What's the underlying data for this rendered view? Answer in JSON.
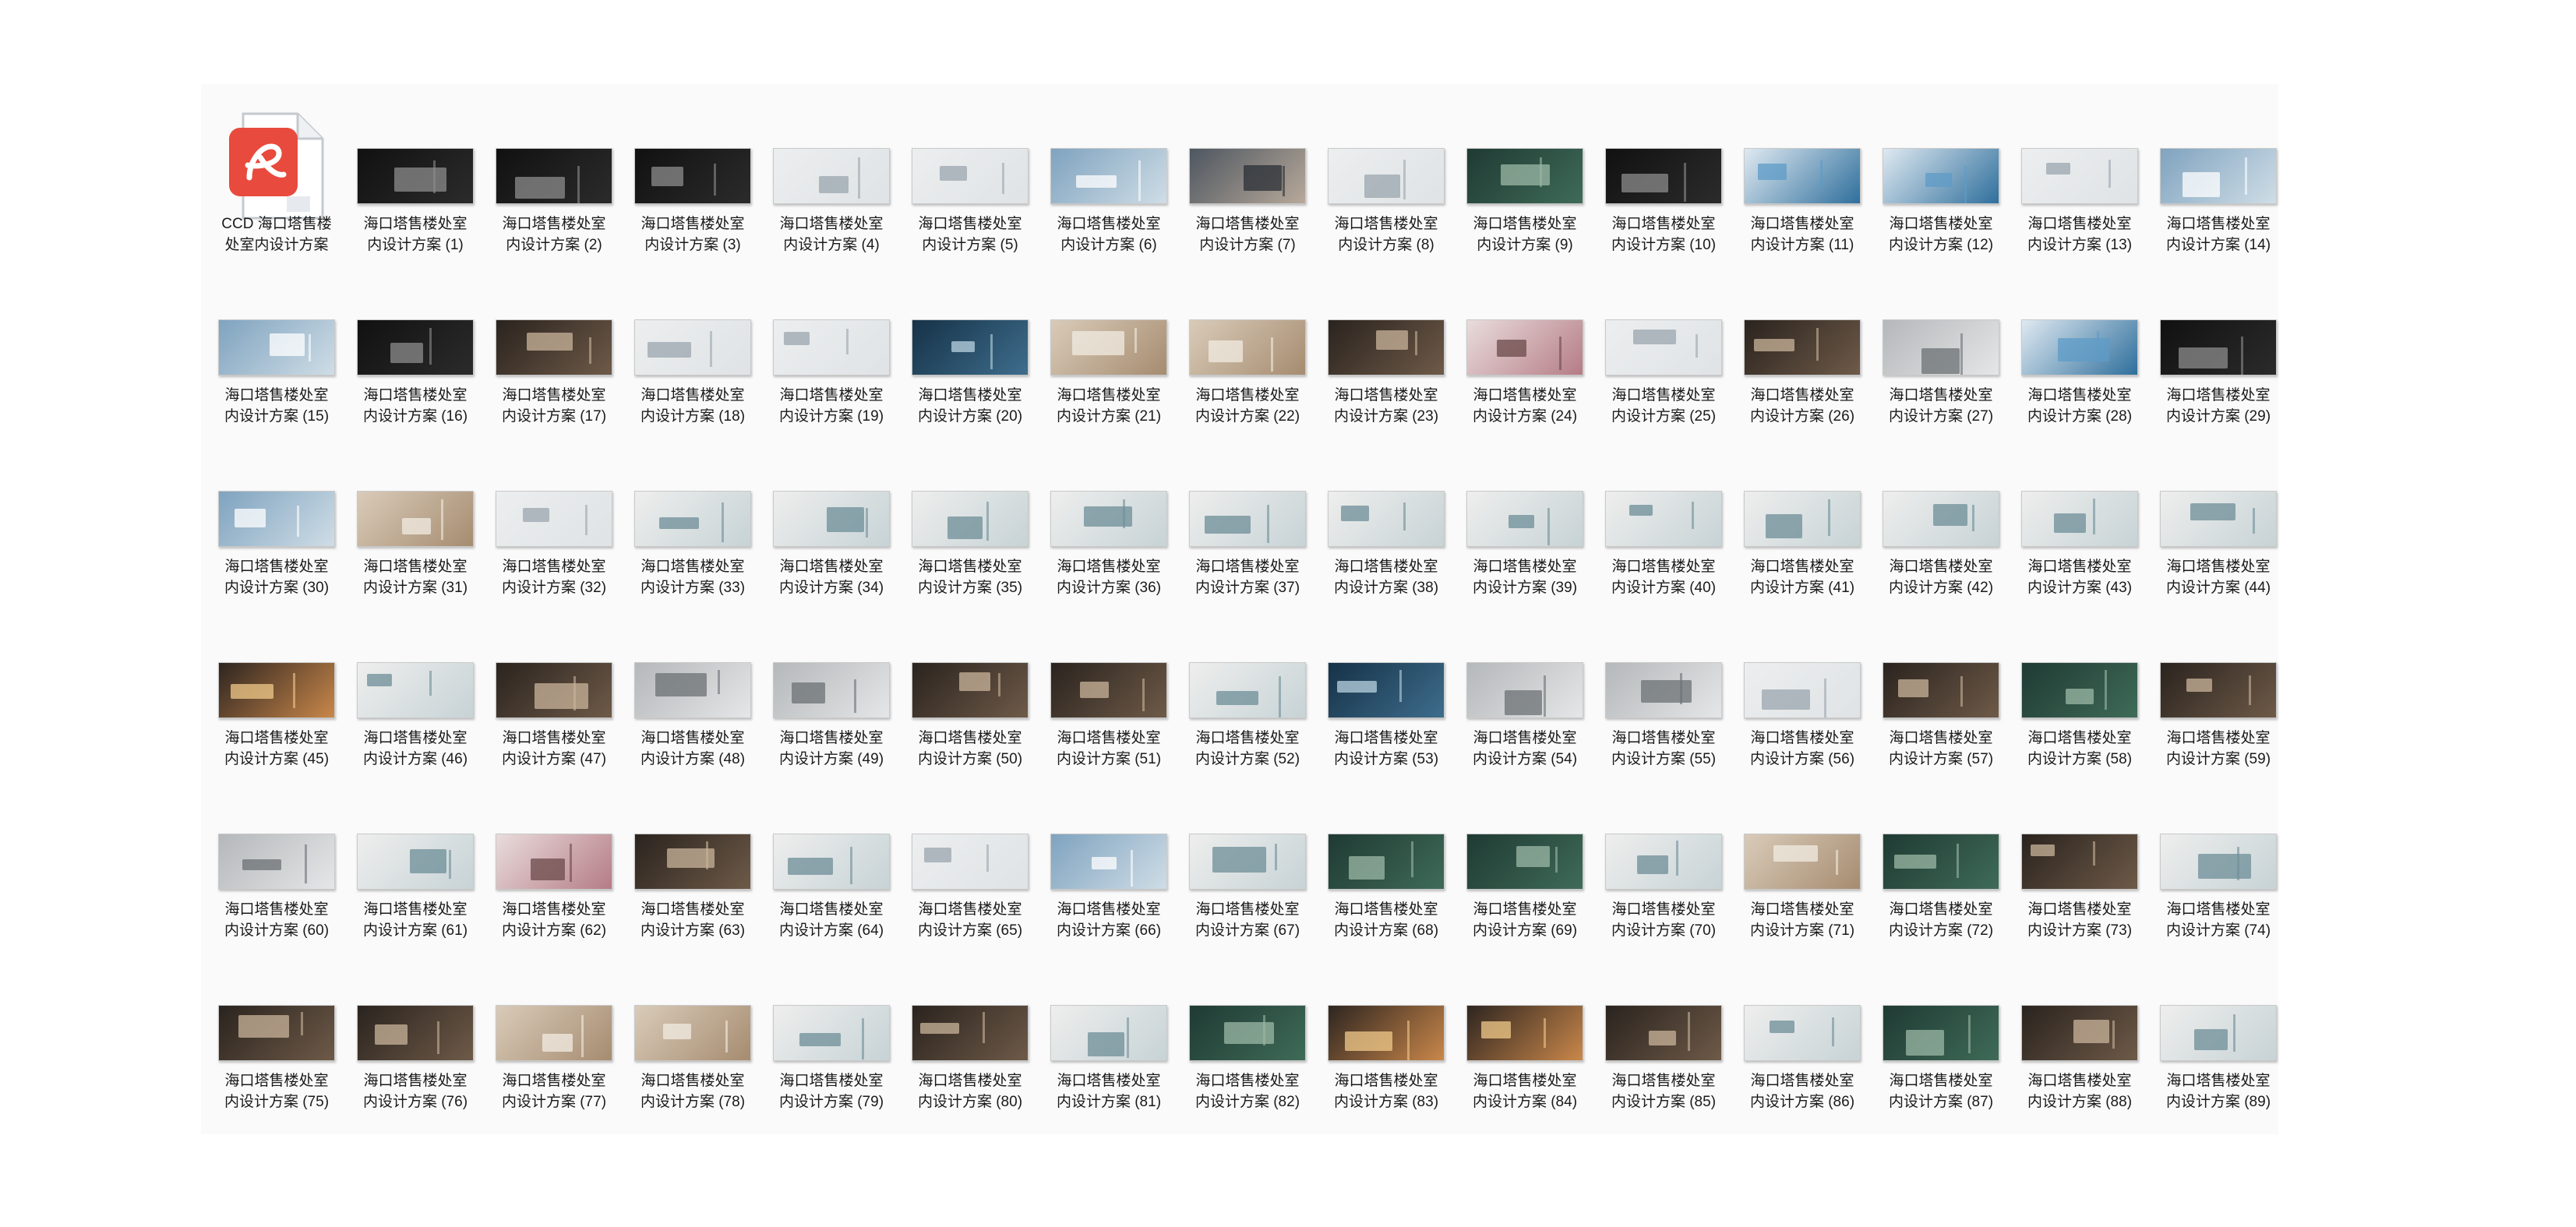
{
  "files": [
    {
      "line1": "CCD 海口塔售楼",
      "line2": "处室内设计方案",
      "type": "pdf",
      "icon": "pdf-file-icon"
    },
    {
      "line1": "海口塔售楼处室",
      "line2": "内设计方案 (1)",
      "theme": "dark"
    },
    {
      "line1": "海口塔售楼处室",
      "line2": "内设计方案 (2)",
      "theme": "dark"
    },
    {
      "line1": "海口塔售楼处室",
      "line2": "内设计方案 (3)",
      "theme": "dark"
    },
    {
      "line1": "海口塔售楼处室",
      "line2": "内设计方案 (4)",
      "theme": "light"
    },
    {
      "line1": "海口塔售楼处室",
      "line2": "内设计方案 (5)",
      "theme": "light"
    },
    {
      "line1": "海口塔售楼处室",
      "line2": "内设计方案 (6)",
      "theme": "sky"
    },
    {
      "line1": "海口塔售楼处室",
      "line2": "内设计方案 (7)",
      "theme": "city"
    },
    {
      "line1": "海口塔售楼处室",
      "line2": "内设计方案 (8)",
      "theme": "light"
    },
    {
      "line1": "海口塔售楼处室",
      "line2": "内设计方案 (9)",
      "theme": "green"
    },
    {
      "line1": "海口塔售楼处室",
      "line2": "内设计方案 (10)",
      "theme": "dark"
    },
    {
      "line1": "海口塔售楼处室",
      "line2": "内设计方案 (11)",
      "theme": "blue"
    },
    {
      "line1": "海口塔售楼处室",
      "line2": "内设计方案 (12)",
      "theme": "blue"
    },
    {
      "line1": "海口塔售楼处室",
      "line2": "内设计方案 (13)",
      "theme": "light"
    },
    {
      "line1": "海口塔售楼处室",
      "line2": "内设计方案 (14)",
      "theme": "sky"
    },
    {
      "line1": "海口塔售楼处室",
      "line2": "内设计方案 (15)",
      "theme": "sky"
    },
    {
      "line1": "海口塔售楼处室",
      "line2": "内设计方案 (16)",
      "theme": "dark"
    },
    {
      "line1": "海口塔售楼处室",
      "line2": "内设计方案 (17)",
      "theme": "interior"
    },
    {
      "line1": "海口塔售楼处室",
      "line2": "内设计方案 (18)",
      "theme": "light"
    },
    {
      "line1": "海口塔售楼处室",
      "line2": "内设计方案 (19)",
      "theme": "light"
    },
    {
      "line1": "海口塔售楼处室",
      "line2": "内设计方案 (20)",
      "theme": "sea"
    },
    {
      "line1": "海口塔售楼处室",
      "line2": "内设计方案 (21)",
      "theme": "warm"
    },
    {
      "line1": "海口塔售楼处室",
      "line2": "内设计方案 (22)",
      "theme": "warm"
    },
    {
      "line1": "海口塔售楼处室",
      "line2": "内设计方案 (23)",
      "theme": "interior"
    },
    {
      "line1": "海口塔售楼处室",
      "line2": "内设计方案 (24)",
      "theme": "pink"
    },
    {
      "line1": "海口塔售楼处室",
      "line2": "内设计方案 (25)",
      "theme": "light"
    },
    {
      "line1": "海口塔售楼处室",
      "line2": "内设计方案 (26)",
      "theme": "interior"
    },
    {
      "line1": "海口塔售楼处室",
      "line2": "内设计方案 (27)",
      "theme": "gray"
    },
    {
      "line1": "海口塔售楼处室",
      "line2": "内设计方案 (28)",
      "theme": "blue"
    },
    {
      "line1": "海口塔售楼处室",
      "line2": "内设计方案 (29)",
      "theme": "dark"
    },
    {
      "line1": "海口塔售楼处室",
      "line2": "内设计方案 (30)",
      "theme": "sky"
    },
    {
      "line1": "海口塔售楼处室",
      "line2": "内设计方案 (31)",
      "theme": "warm"
    },
    {
      "line1": "海口塔售楼处室",
      "line2": "内设计方案 (32)",
      "theme": "light"
    },
    {
      "line1": "海口塔售楼处室",
      "line2": "内设计方案 (33)",
      "theme": "plan"
    },
    {
      "line1": "海口塔售楼处室",
      "line2": "内设计方案 (34)",
      "theme": "plan"
    },
    {
      "line1": "海口塔售楼处室",
      "line2": "内设计方案 (35)",
      "theme": "plan"
    },
    {
      "line1": "海口塔售楼处室",
      "line2": "内设计方案 (36)",
      "theme": "plan"
    },
    {
      "line1": "海口塔售楼处室",
      "line2": "内设计方案 (37)",
      "theme": "plan"
    },
    {
      "line1": "海口塔售楼处室",
      "line2": "内设计方案 (38)",
      "theme": "plan"
    },
    {
      "line1": "海口塔售楼处室",
      "line2": "内设计方案 (39)",
      "theme": "plan"
    },
    {
      "line1": "海口塔售楼处室",
      "line2": "内设计方案 (40)",
      "theme": "plan"
    },
    {
      "line1": "海口塔售楼处室",
      "line2": "内设计方案 (41)",
      "theme": "plan"
    },
    {
      "line1": "海口塔售楼处室",
      "line2": "内设计方案 (42)",
      "theme": "plan"
    },
    {
      "line1": "海口塔售楼处室",
      "line2": "内设计方案 (43)",
      "theme": "plan"
    },
    {
      "line1": "海口塔售楼处室",
      "line2": "内设计方案 (44)",
      "theme": "plan"
    },
    {
      "line1": "海口塔售楼处室",
      "line2": "内设计方案 (45)",
      "theme": "sunset"
    },
    {
      "line1": "海口塔售楼处室",
      "line2": "内设计方案 (46)",
      "theme": "plan"
    },
    {
      "line1": "海口塔售楼处室",
      "line2": "内设计方案 (47)",
      "theme": "interior"
    },
    {
      "line1": "海口塔售楼处室",
      "line2": "内设计方案 (48)",
      "theme": "gray"
    },
    {
      "line1": "海口塔售楼处室",
      "line2": "内设计方案 (49)",
      "theme": "gray"
    },
    {
      "line1": "海口塔售楼处室",
      "line2": "内设计方案 (50)",
      "theme": "interior"
    },
    {
      "line1": "海口塔售楼处室",
      "line2": "内设计方案 (51)",
      "theme": "interior"
    },
    {
      "line1": "海口塔售楼处室",
      "line2": "内设计方案 (52)",
      "theme": "plan"
    },
    {
      "line1": "海口塔售楼处室",
      "line2": "内设计方案 (53)",
      "theme": "sea"
    },
    {
      "line1": "海口塔售楼处室",
      "line2": "内设计方案 (54)",
      "theme": "gray"
    },
    {
      "line1": "海口塔售楼处室",
      "line2": "内设计方案 (55)",
      "theme": "gray"
    },
    {
      "line1": "海口塔售楼处室",
      "line2": "内设计方案 (56)",
      "theme": "light"
    },
    {
      "line1": "海口塔售楼处室",
      "line2": "内设计方案 (57)",
      "theme": "interior"
    },
    {
      "line1": "海口塔售楼处室",
      "line2": "内设计方案 (58)",
      "theme": "green"
    },
    {
      "line1": "海口塔售楼处室",
      "line2": "内设计方案 (59)",
      "theme": "interior"
    },
    {
      "line1": "海口塔售楼处室",
      "line2": "内设计方案 (60)",
      "theme": "gray"
    },
    {
      "line1": "海口塔售楼处室",
      "line2": "内设计方案 (61)",
      "theme": "plan"
    },
    {
      "line1": "海口塔售楼处室",
      "line2": "内设计方案 (62)",
      "theme": "pink"
    },
    {
      "line1": "海口塔售楼处室",
      "line2": "内设计方案 (63)",
      "theme": "interior"
    },
    {
      "line1": "海口塔售楼处室",
      "line2": "内设计方案 (64)",
      "theme": "plan"
    },
    {
      "line1": "海口塔售楼处室",
      "line2": "内设计方案 (65)",
      "theme": "light"
    },
    {
      "line1": "海口塔售楼处室",
      "line2": "内设计方案 (66)",
      "theme": "sky"
    },
    {
      "line1": "海口塔售楼处室",
      "line2": "内设计方案 (67)",
      "theme": "plan"
    },
    {
      "line1": "海口塔售楼处室",
      "line2": "内设计方案 (68)",
      "theme": "green"
    },
    {
      "line1": "海口塔售楼处室",
      "line2": "内设计方案 (69)",
      "theme": "green"
    },
    {
      "line1": "海口塔售楼处室",
      "line2": "内设计方案 (70)",
      "theme": "plan"
    },
    {
      "line1": "海口塔售楼处室",
      "line2": "内设计方案 (71)",
      "theme": "warm"
    },
    {
      "line1": "海口塔售楼处室",
      "line2": "内设计方案 (72)",
      "theme": "green"
    },
    {
      "line1": "海口塔售楼处室",
      "line2": "内设计方案 (73)",
      "theme": "interior"
    },
    {
      "line1": "海口塔售楼处室",
      "line2": "内设计方案 (74)",
      "theme": "plan"
    },
    {
      "line1": "海口塔售楼处室",
      "line2": "内设计方案 (75)",
      "theme": "interior"
    },
    {
      "line1": "海口塔售楼处室",
      "line2": "内设计方案 (76)",
      "theme": "interior"
    },
    {
      "line1": "海口塔售楼处室",
      "line2": "内设计方案 (77)",
      "theme": "warm"
    },
    {
      "line1": "海口塔售楼处室",
      "line2": "内设计方案 (78)",
      "theme": "warm"
    },
    {
      "line1": "海口塔售楼处室",
      "line2": "内设计方案 (79)",
      "theme": "plan"
    },
    {
      "line1": "海口塔售楼处室",
      "line2": "内设计方案 (80)",
      "theme": "interior"
    },
    {
      "line1": "海口塔售楼处室",
      "line2": "内设计方案 (81)",
      "theme": "plan"
    },
    {
      "line1": "海口塔售楼处室",
      "line2": "内设计方案 (82)",
      "theme": "green"
    },
    {
      "line1": "海口塔售楼处室",
      "line2": "内设计方案 (83)",
      "theme": "sunset"
    },
    {
      "line1": "海口塔售楼处室",
      "line2": "内设计方案 (84)",
      "theme": "sunset"
    },
    {
      "line1": "海口塔售楼处室",
      "line2": "内设计方案 (85)",
      "theme": "interior"
    },
    {
      "line1": "海口塔售楼处室",
      "line2": "内设计方案 (86)",
      "theme": "plan"
    },
    {
      "line1": "海口塔售楼处室",
      "line2": "内设计方案 (87)",
      "theme": "green"
    },
    {
      "line1": "海口塔售楼处室",
      "line2": "内设计方案 (88)",
      "theme": "interior"
    },
    {
      "line1": "海口塔售楼处室",
      "line2": "内设计方案 (89)",
      "theme": "plan"
    }
  ],
  "colors": {
    "panel": "#fafafa",
    "caption_text": "#1a1a1a",
    "pdf_red": "#e84a3d"
  }
}
